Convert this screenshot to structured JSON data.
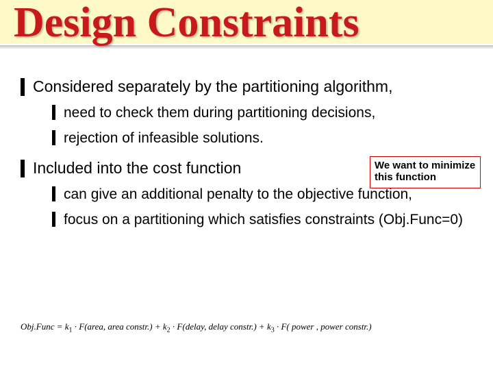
{
  "title": "Design Constraints",
  "bullets": {
    "b1": "Considered separately by the partitioning algorithm,",
    "b1a": "need to check them during partitioning decisions,",
    "b1b": "rejection of infeasible solutions.",
    "b2": "Included into the cost function",
    "b2a": "can give an additional penalty to the objective function,",
    "b2b": "focus on a partitioning which satisfies constraints (Obj.Func=0)"
  },
  "callout": "We want to minimize this function",
  "formula_parts": {
    "lhs": "Obj.Func = k",
    "k1sub": "1",
    "t1": " · F(area, area   constr.) + k",
    "k2sub": "2",
    "t2": " · F(delay, delay   constr.) + k",
    "k3sub": "3",
    "t3": " · F( power , power   constr.)"
  }
}
